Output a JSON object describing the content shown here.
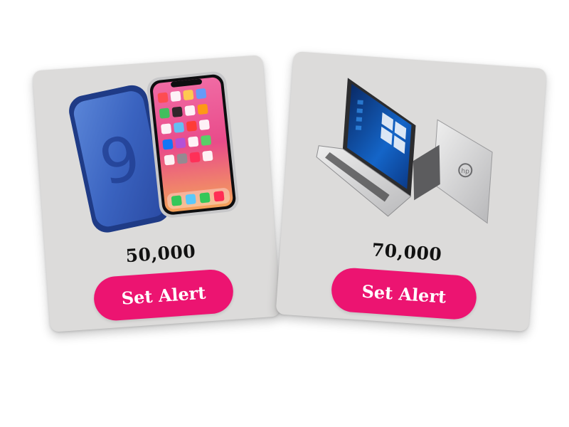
{
  "products": [
    {
      "price": "50,000",
      "button_label": "Set Alert",
      "image_icon": "smartphones-image-icon"
    },
    {
      "price": "70,000",
      "button_label": "Set Alert",
      "image_icon": "laptops-image-icon"
    }
  ],
  "colors": {
    "card_bg": "#dcdbda",
    "button_bg": "#ec1471",
    "button_text": "#ffffff",
    "price_text": "#111111"
  }
}
